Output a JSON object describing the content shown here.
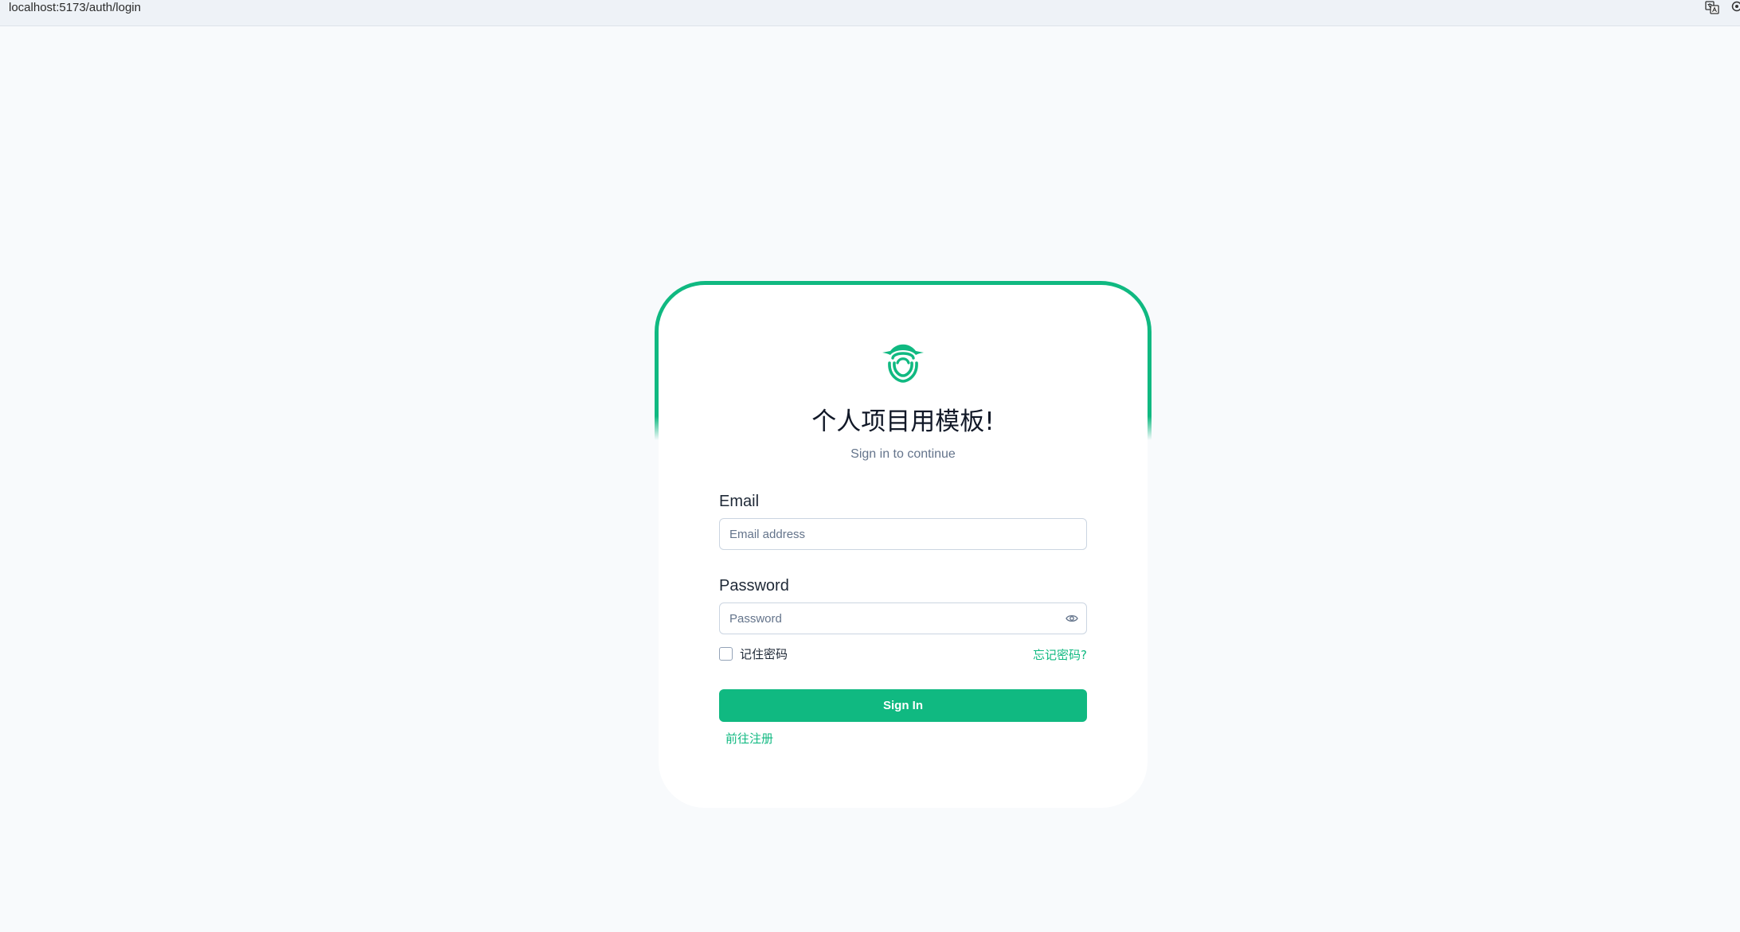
{
  "browser": {
    "url": "localhost:5173/auth/login",
    "icons": [
      "translate-icon",
      "edge-icon"
    ]
  },
  "login": {
    "logo_icon": "smile-logo-icon",
    "title": "个人项目用模板!",
    "subtitle": "Sign in to continue",
    "email_label": "Email",
    "email_placeholder": "Email address",
    "email_value": "",
    "password_label": "Password",
    "password_placeholder": "Password",
    "password_value": "",
    "password_toggle_icon": "eye-icon",
    "remember_label": "记住密码",
    "remember_checked": false,
    "forgot_label": "忘记密码?",
    "signin_label": "Sign In",
    "register_label": "前往注册"
  },
  "colors": {
    "accent": "#10b981",
    "background": "#f8fafc",
    "card": "#ffffff"
  }
}
